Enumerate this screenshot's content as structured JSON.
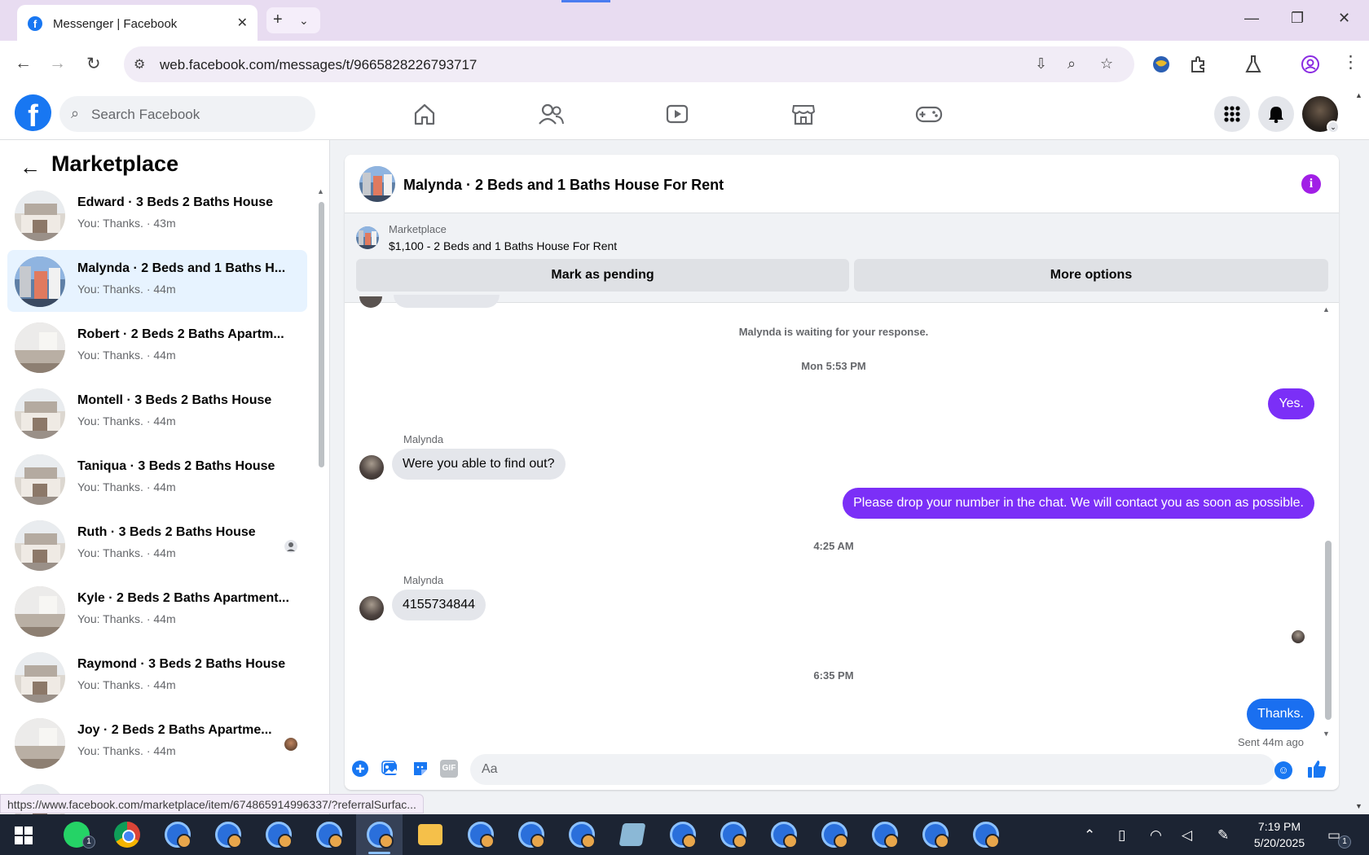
{
  "browser": {
    "tab_title": "Messenger | Facebook",
    "tab_favicon": "f",
    "url": "web.facebook.com/messages/t/9665828226793717",
    "status_url": "https://www.facebook.com/marketplace/item/674865914996337/?referralSurfac..."
  },
  "fb": {
    "search_placeholder": "Search Facebook",
    "logo": "f"
  },
  "left_panel": {
    "title": "Marketplace",
    "conversations": [
      {
        "name": "Edward · 3 Beds 2 Baths House",
        "preview": "You: Thanks. · 43m"
      },
      {
        "name": "Malynda · 2 Beds and 1 Baths H...",
        "preview": "You: Thanks. · 44m"
      },
      {
        "name": "Robert · 2 Beds 2 Baths Apartm...",
        "preview": "You: Thanks. · 44m"
      },
      {
        "name": "Montell · 3 Beds 2 Baths House",
        "preview": "You: Thanks. · 44m"
      },
      {
        "name": "Taniqua · 3 Beds 2 Baths House",
        "preview": "You: Thanks. · 44m"
      },
      {
        "name": "Ruth · 3 Beds 2 Baths House",
        "preview": "You: Thanks. · 44m"
      },
      {
        "name": "Kyle · 2 Beds 2 Baths Apartment...",
        "preview": "You: Thanks. · 44m"
      },
      {
        "name": "Raymond · 3 Beds 2 Baths House",
        "preview": "You: Thanks. · 44m"
      },
      {
        "name": "Joy · 2 Beds 2 Baths Apartme...",
        "preview": "You: Thanks. · 44m"
      }
    ]
  },
  "chat": {
    "title": "Malynda · 2 Beds and 1 Baths House For Rent",
    "info_icon": "i",
    "listing_label": "Marketplace",
    "listing_price": "$1,100 - 2 Beds and 1 Baths House For Rent",
    "mark_pending": "Mark as pending",
    "more_options": "More options",
    "waiting_notice": "Malynda is waiting for your response.",
    "timestamps": [
      "Mon 5:53 PM",
      "4:25 AM",
      "6:35 PM"
    ],
    "messages": [
      {
        "from": "me",
        "text": "Yes."
      },
      {
        "from": "Malynda",
        "sender": "Malynda",
        "text": "Were you able to find out?"
      },
      {
        "from": "me",
        "text": "Please drop your number in the chat. We will contact you as soon as possible."
      },
      {
        "from": "Malynda",
        "sender": "Malynda",
        "text": "4155734844"
      },
      {
        "from": "me",
        "text": "Thanks."
      }
    ],
    "sent_status": "Sent 44m ago",
    "composer_placeholder": "Aa",
    "gif_label": "GIF"
  },
  "taskbar": {
    "time": "7:19 PM",
    "date": "5/20/2025",
    "whatsapp_badge": "1",
    "notification_badge": "1"
  },
  "colors": {
    "facebook_blue": "#1877f2",
    "outgoing_purple": "#7b2ff7",
    "outgoing_blue": "#1a6ff0",
    "info_purple": "#a11fe6",
    "active_conversation_bg": "#e7f3ff"
  }
}
